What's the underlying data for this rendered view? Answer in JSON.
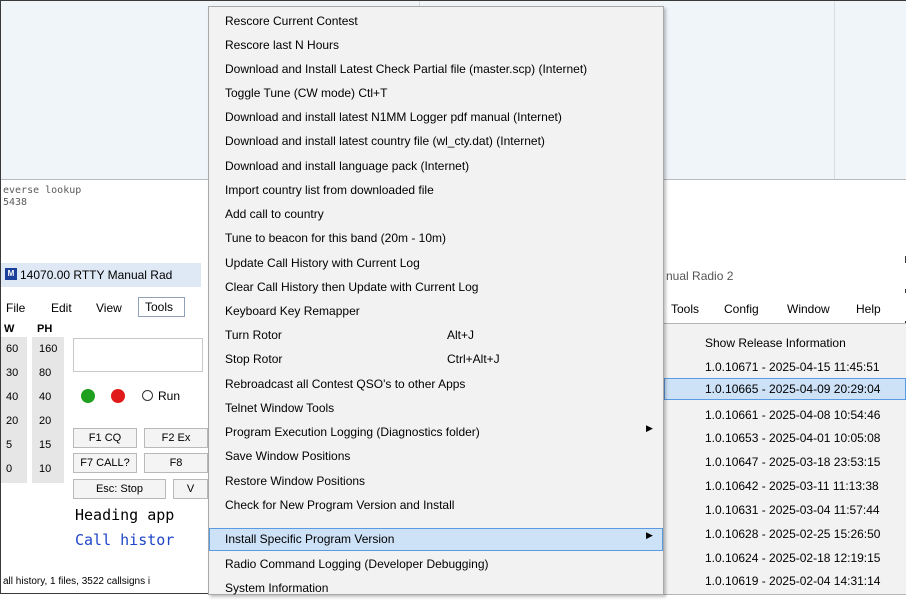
{
  "background": {
    "mono_lines": [
      "everse lookup",
      "5438"
    ]
  },
  "left_window": {
    "title": "14070.00 RTTY Manual Rad",
    "menu": [
      "File",
      "Edit",
      "View",
      "Tools"
    ],
    "band_headers": [
      "W",
      "PH"
    ],
    "band_col1": [
      "60",
      "30",
      "40",
      "20",
      "5",
      "0"
    ],
    "band_col2": [
      "160",
      "80",
      "40",
      "20",
      "15",
      "10"
    ],
    "run_label": "Run",
    "buttons": {
      "f1": "F1 CQ",
      "f2": "F2 Ex",
      "f7": "F7 CALL?",
      "f8": "F8",
      "esc": "Esc: Stop",
      "partial": "V"
    },
    "heading_text": "Heading app",
    "callhist_text": "Call histor",
    "status_text": "all history, 1 files, 3522 callsigns i"
  },
  "right_window": {
    "title": "nual Radio 2",
    "menu": [
      "Tools",
      "Config",
      "Window",
      "Help"
    ]
  },
  "dropdown": {
    "items": [
      {
        "label": "Rescore Current Contest"
      },
      {
        "label": "Rescore last N Hours"
      },
      {
        "label": "Download and Install Latest Check Partial file (master.scp) (Internet)"
      },
      {
        "label": "Toggle Tune (CW mode)  Ctl+T"
      },
      {
        "label": "Download and install latest N1MM Logger pdf manual (Internet)"
      },
      {
        "label": "Download and install latest country file (wl_cty.dat) (Internet)"
      },
      {
        "label": "Download and install language pack (Internet)"
      },
      {
        "label": "Import country list from downloaded file"
      },
      {
        "label": "Add call to country"
      },
      {
        "label": "Tune to beacon for this band  (20m - 10m)"
      },
      {
        "label": "Update Call History with Current Log"
      },
      {
        "label": "Clear Call History then Update with Current Log"
      },
      {
        "label": "Keyboard Key Remapper"
      },
      {
        "label": "Turn Rotor",
        "shortcut": "Alt+J"
      },
      {
        "label": "Stop Rotor",
        "shortcut": "Ctrl+Alt+J"
      },
      {
        "label": "Rebroadcast all Contest QSO's to other Apps"
      },
      {
        "label": "Telnet Window Tools"
      },
      {
        "label": "Program Execution Logging (Diagnostics folder)",
        "arrow": "▶"
      },
      {
        "label": "Save Window Positions"
      },
      {
        "label": "Restore Window Positions"
      },
      {
        "label": "Check for New Program Version and Install"
      },
      {
        "label": "Install Specific Program Version",
        "arrow": "▶",
        "highlighted": true
      },
      {
        "label": "Radio Command Logging  (Developer Debugging)"
      },
      {
        "label": "System Information"
      }
    ]
  },
  "submenu": {
    "items": [
      {
        "label": "Show Release Information"
      },
      {
        "label": "1.0.10671 - 2025-04-15 11:45:51"
      },
      {
        "label": "1.0.10665 - 2025-04-09 20:29:04",
        "highlighted": true
      },
      {
        "label": "1.0.10661 - 2025-04-08 10:54:46"
      },
      {
        "label": "1.0.10653 - 2025-04-01 10:05:08"
      },
      {
        "label": "1.0.10647 - 2025-03-18 23:53:15"
      },
      {
        "label": "1.0.10642 - 2025-03-11 11:13:38"
      },
      {
        "label": "1.0.10631 - 2025-03-04 11:57:44"
      },
      {
        "label": "1.0.10628 - 2025-02-25 15:26:50"
      },
      {
        "label": "1.0.10624 - 2025-02-18 12:19:15"
      },
      {
        "label": "1.0.10619 - 2025-02-04 14:31:14"
      }
    ]
  },
  "colors": {
    "menu_bg": "#f2f2f2",
    "highlight_bg": "#cde1f7",
    "highlight_border": "#5a9ae0",
    "callhistory_text": "#1f45c8",
    "green_dot": "#1fa01f",
    "red_dot": "#e01a1a"
  }
}
